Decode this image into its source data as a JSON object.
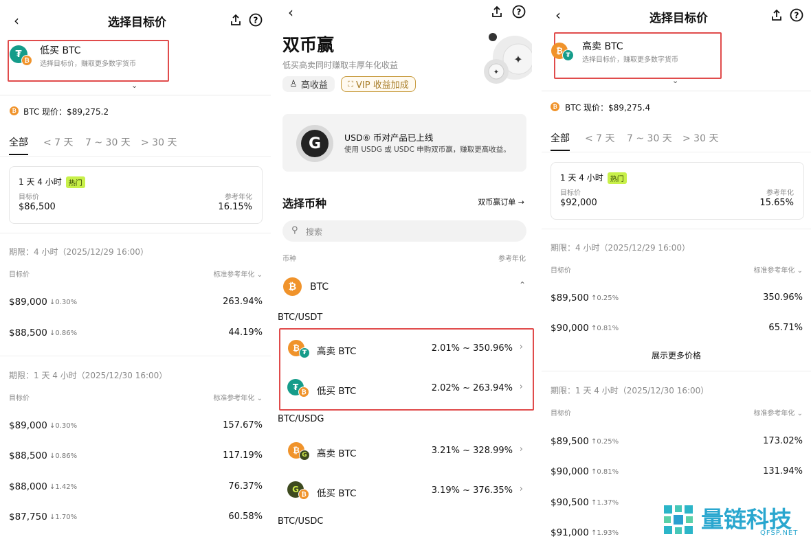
{
  "panel1": {
    "title": "选择目标价",
    "product_name": "低买 BTC",
    "product_desc": "选择目标价，赚取更多数字货币",
    "current_price": "BTC 现价：$89,275.2",
    "tabs": [
      "全部",
      "< 7 天",
      "7 ~ 30 天",
      "> 30 天"
    ],
    "card": {
      "duration": "1 天 4 小时",
      "badge": "热门",
      "target_label": "目标价",
      "target_value": "$86,500",
      "apr_label": "参考年化",
      "apr_value": "16.15%"
    },
    "section1": {
      "period": "期限：4 小时（2025/12/29 16:00）",
      "col_left": "目标价",
      "col_right": "标准参考年化",
      "rows": [
        {
          "price": "$89,000",
          "change": "0.30%",
          "apr": "263.94%"
        },
        {
          "price": "$88,500",
          "change": "0.86%",
          "apr": "44.19%"
        }
      ]
    },
    "section2": {
      "period": "期限：1 天 4 小时（2025/12/30 16:00）",
      "col_left": "目标价",
      "col_right": "标准参考年化",
      "rows": [
        {
          "price": "$89,000",
          "change": "0.30%",
          "apr": "157.67%"
        },
        {
          "price": "$88,500",
          "change": "0.86%",
          "apr": "117.19%"
        },
        {
          "price": "$88,000",
          "change": "1.42%",
          "apr": "76.37%"
        },
        {
          "price": "$87,750",
          "change": "1.70%",
          "apr": "60.58%"
        }
      ]
    }
  },
  "panel2": {
    "title": "双币赢",
    "subtitle": "低买高卖同时赚取丰厚年化收益",
    "tag_high": "高收益",
    "tag_vip": "VIP 收益加成",
    "banner_title": "USD⑥ 币对产品已上线",
    "banner_desc": "使用 USDG 或 USDC 申购双币赢，赚取更高收益。",
    "select_coin": "选择币种",
    "orders_link": "双币赢订单",
    "search_placeholder": "搜索",
    "col_coin": "币种",
    "col_apr": "参考年化",
    "coin_name": "BTC",
    "group1": "BTC/USDT",
    "group1_items": [
      {
        "name": "高卖 BTC",
        "range": "2.01% ~ 350.96%"
      },
      {
        "name": "低买 BTC",
        "range": "2.02% ~ 263.94%"
      }
    ],
    "group2": "BTC/USDG",
    "group2_items": [
      {
        "name": "高卖 BTC",
        "range": "3.21% ~ 328.99%"
      },
      {
        "name": "低买 BTC",
        "range": "3.19% ~ 376.35%"
      }
    ],
    "group3": "BTC/USDC"
  },
  "panel3": {
    "title": "选择目标价",
    "product_name": "高卖 BTC",
    "product_desc": "选择目标价，赚取更多数字货币",
    "current_price": "BTC 现价：$89,275.4",
    "tabs": [
      "全部",
      "< 7 天",
      "7 ~ 30 天",
      "> 30 天"
    ],
    "card": {
      "duration": "1 天 4 小时",
      "badge": "热门",
      "target_label": "目标价",
      "target_value": "$92,000",
      "apr_label": "参考年化",
      "apr_value": "15.65%"
    },
    "section1": {
      "period": "期限：4 小时（2025/12/29 16:00）",
      "col_left": "目标价",
      "col_right": "标准参考年化",
      "rows": [
        {
          "price": "$89,500",
          "change": "0.25%",
          "apr": "350.96%"
        },
        {
          "price": "$90,000",
          "change": "0.81%",
          "apr": "65.71%"
        }
      ]
    },
    "show_more": "展示更多价格",
    "section2": {
      "period": "期限：1 天 4 小时（2025/12/30 16:00）",
      "col_left": "目标价",
      "col_right": "标准参考年化",
      "rows": [
        {
          "price": "$89,500",
          "change": "0.25%",
          "apr": "173.02%"
        },
        {
          "price": "$90,000",
          "change": "0.81%",
          "apr": "131.94%"
        },
        {
          "price": "$90,500",
          "change": "1.37%",
          "apr": ""
        },
        {
          "price": "$91,000",
          "change": "1.93%",
          "apr": ""
        }
      ]
    }
  },
  "watermark": {
    "name": "量链科技",
    "site": "QFSP.NET"
  },
  "colors": {
    "accent_red": "#e04b4b",
    "btc_orange": "#f0932b",
    "usdt_teal": "#159c8a",
    "hot_green": "#c8f04a",
    "vip_gold": "#c79a3c"
  }
}
